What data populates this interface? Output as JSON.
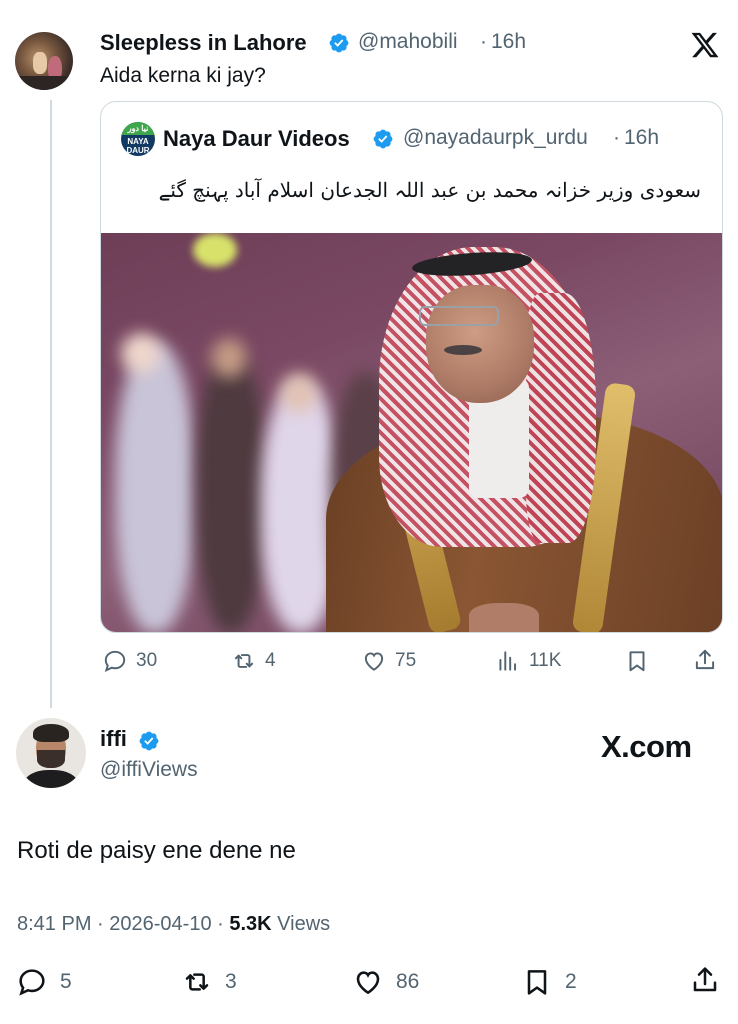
{
  "tweet1": {
    "author_name": "Sleepless in Lahore",
    "handle": "@mahobili",
    "separator": "·",
    "time": "16h",
    "text": "Aida kerna ki jay?",
    "stats": {
      "replies": "30",
      "reposts": "4",
      "likes": "75",
      "views": "11K"
    }
  },
  "quote": {
    "avatar_top": "نیا دور",
    "avatar_text": "NAYA DAUR",
    "author_name": "Naya Daur Videos",
    "handle": "@nayadaurpk_urdu",
    "separator": "·",
    "time": "16h",
    "text": "سعودی وزیر خزانہ محمد بن عبد اللہ الجدعان اسلام آباد پہنچ گئے"
  },
  "tweet2": {
    "author_name": "iffi",
    "handle": "@iffiViews",
    "brand": "X.com",
    "text": "Roti de paisy ene dene ne",
    "timestamp": "8:41 PM · 2026-04-10 · ",
    "views_count": "5.3K",
    "views_label": " Views",
    "stats": {
      "replies": "5",
      "reposts": "3",
      "likes": "86",
      "bookmarks": "2"
    }
  },
  "colors": {
    "verified": "#1d9bf0",
    "secondary_text": "#536471",
    "primary_text": "#0f1419",
    "border": "#cfd9de"
  },
  "icons": [
    "x-logo-icon",
    "verified-badge-icon",
    "reply-icon",
    "repost-icon",
    "like-icon",
    "views-icon",
    "bookmark-icon",
    "share-icon"
  ]
}
